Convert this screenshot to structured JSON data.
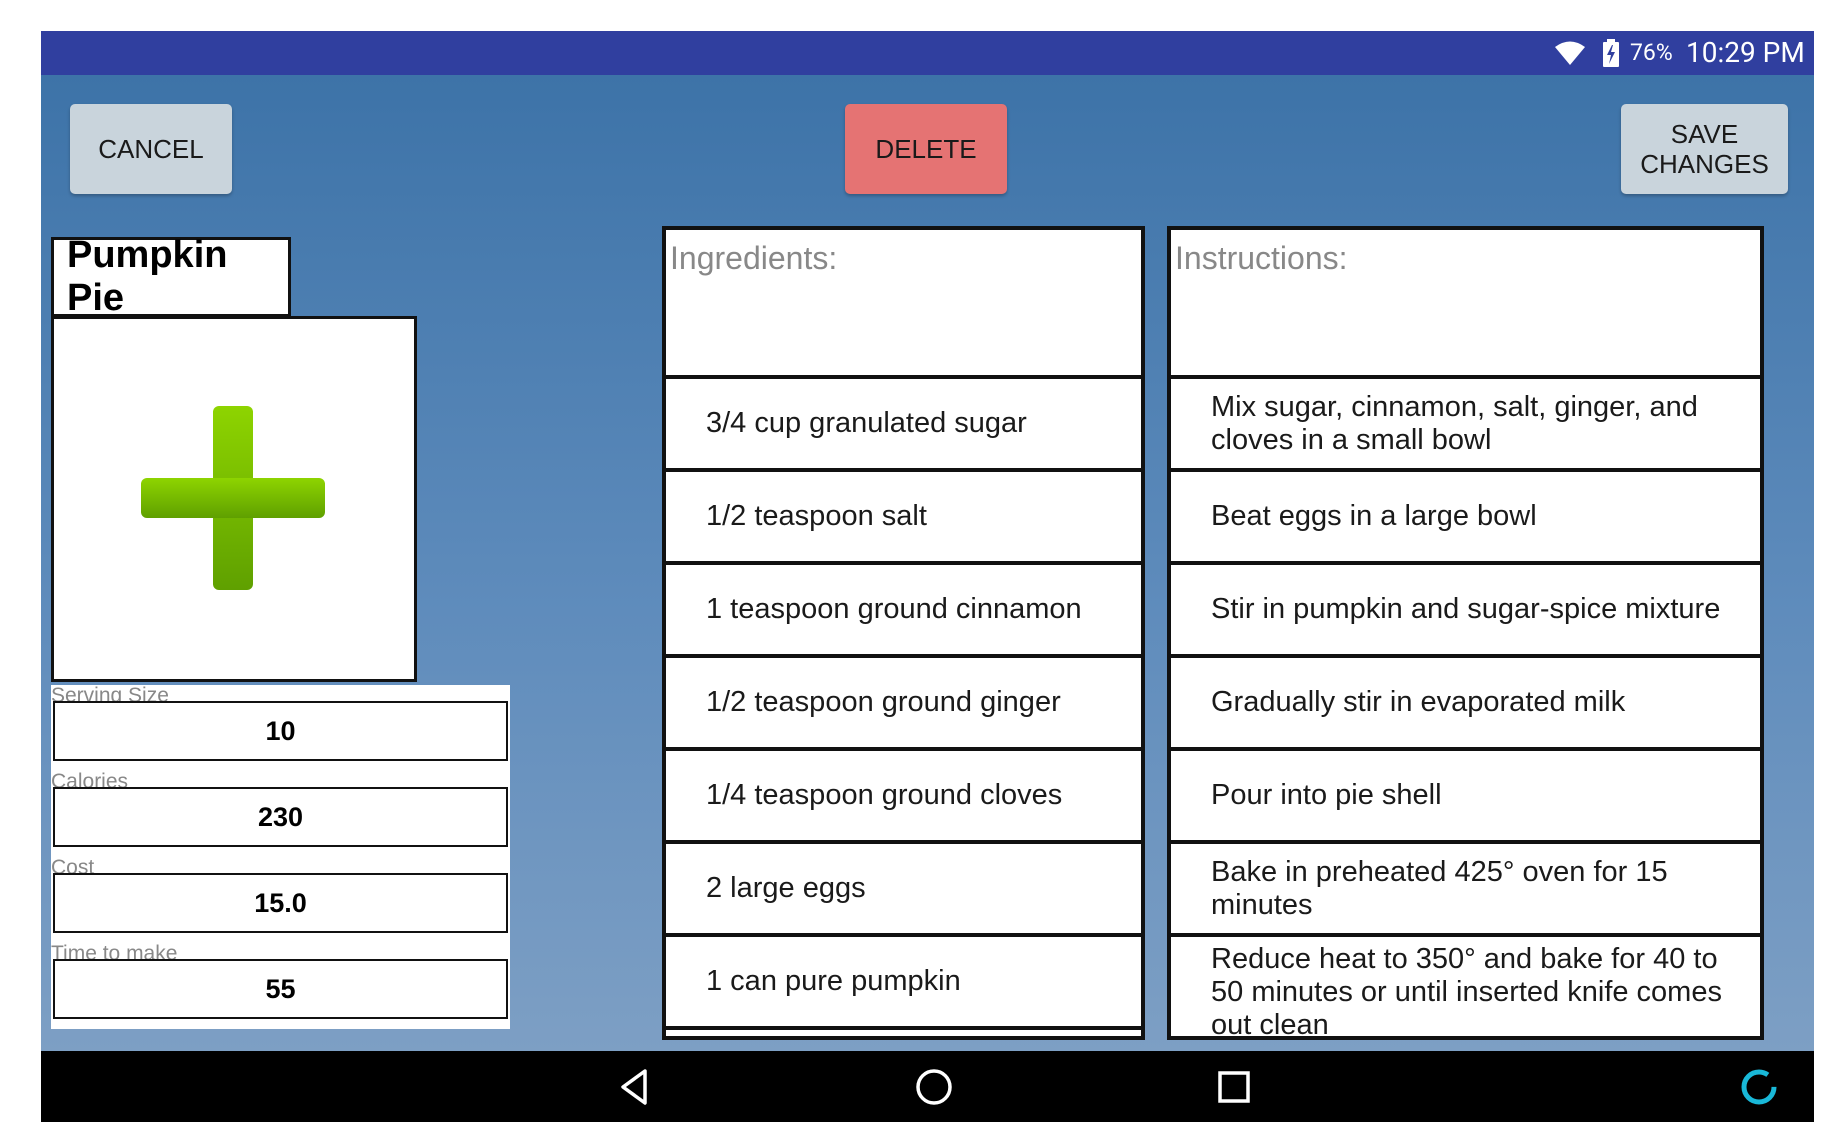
{
  "status_bar": {
    "battery_pct": "76%",
    "time": "10:29 PM",
    "wifi_icon": "wifi-icon",
    "battery_icon": "battery-charging-icon"
  },
  "toolbar": {
    "cancel_label": "CANCEL",
    "delete_label": "DELETE",
    "save_label_line1": "SAVE",
    "save_label_line2": "CHANGES"
  },
  "recipe": {
    "title": "Pumpkin Pie",
    "image_icon": "add-plus-icon",
    "serving_size_label": "Serving Size",
    "serving_size": "10",
    "calories_label": "Calories",
    "calories": "230",
    "cost_label": "Cost",
    "cost": "15.0",
    "time_label": "Time to make",
    "time": "55"
  },
  "ingredients": {
    "header": "Ingredients:",
    "items": [
      "3/4 cup granulated sugar",
      "1/2 teaspoon salt",
      "1 teaspoon ground cinnamon",
      "1/2 teaspoon ground ginger",
      "1/4 teaspoon ground cloves",
      "2 large eggs",
      "1 can pure pumpkin"
    ]
  },
  "instructions": {
    "header": "Instructions:",
    "items": [
      "Mix sugar, cinnamon, salt, ginger, and cloves in a small bowl",
      "Beat eggs in a large bowl",
      "Stir in pumpkin and sugar-spice mixture",
      "Gradually stir in evaporated milk",
      "Pour into pie shell",
      "Bake in preheated 425° oven for 15 minutes",
      "Reduce heat to 350° and bake for 40 to 50 minutes or until inserted knife comes out clean"
    ]
  },
  "nav_bar": {
    "back_icon": "back-icon",
    "home_icon": "home-icon",
    "recents_icon": "recents-icon",
    "assistant_icon": "assistant-icon"
  },
  "colors": {
    "status_bar": "#303F9F",
    "delete_button": "#e57373",
    "neutral_button": "#c9d4dc",
    "plus_green": "#7cc400"
  }
}
